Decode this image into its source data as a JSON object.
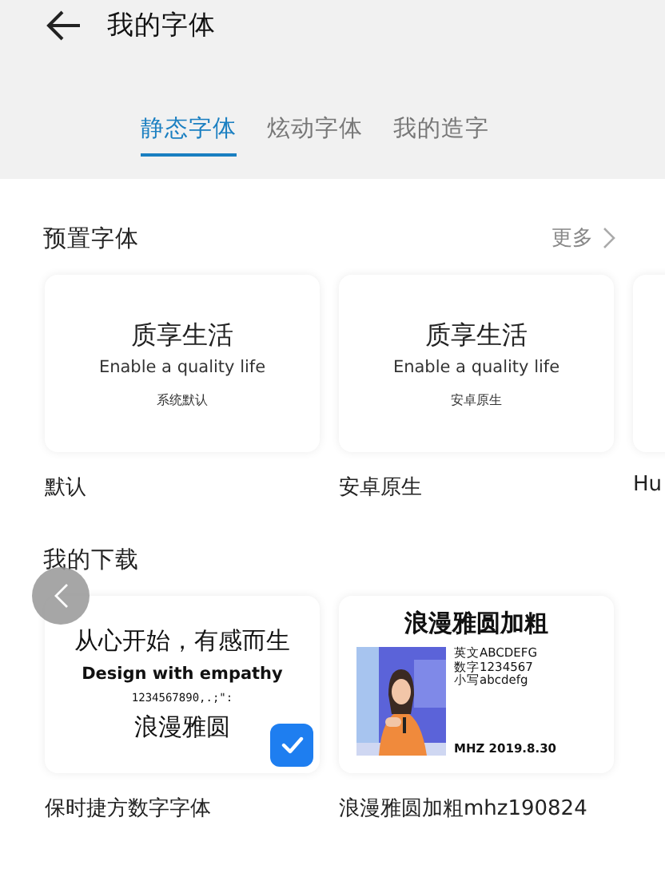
{
  "title": "我的字体",
  "tabs": [
    {
      "label": "静态字体",
      "selected": true
    },
    {
      "label": "炫动字体",
      "selected": false
    },
    {
      "label": "我的造字",
      "selected": false
    }
  ],
  "sections": [
    {
      "title": "预置字体",
      "more": "更多",
      "fonts": [
        {
          "kind": "sample",
          "heading": "质享生活",
          "english": "Enable a quality life",
          "caption": "系统默认",
          "name": "默认"
        },
        {
          "kind": "sample",
          "heading": "质享生活",
          "english": "Enable a quality life",
          "caption": "安卓原生",
          "name": "安卓原生"
        },
        {
          "kind": "blank",
          "name": "Hu"
        }
      ]
    },
    {
      "title": "我的下载",
      "fonts": [
        {
          "kind": "specimen",
          "lines": [
            "从心开始，有感而生",
            "Design with empathy",
            "1234567890,.;\":",
            "浪漫雅圆"
          ],
          "selected": true,
          "name": "保时捷方数字字体"
        },
        {
          "kind": "poster",
          "heading": "浪漫雅圆加粗",
          "lines": [
            "英文ABCDEFG",
            "数字1234567",
            "小写abcdefg"
          ],
          "footer": "MHZ 2019.8.30",
          "selected": false,
          "name": "浪漫雅圆加粗mhz190824"
        }
      ]
    }
  ]
}
